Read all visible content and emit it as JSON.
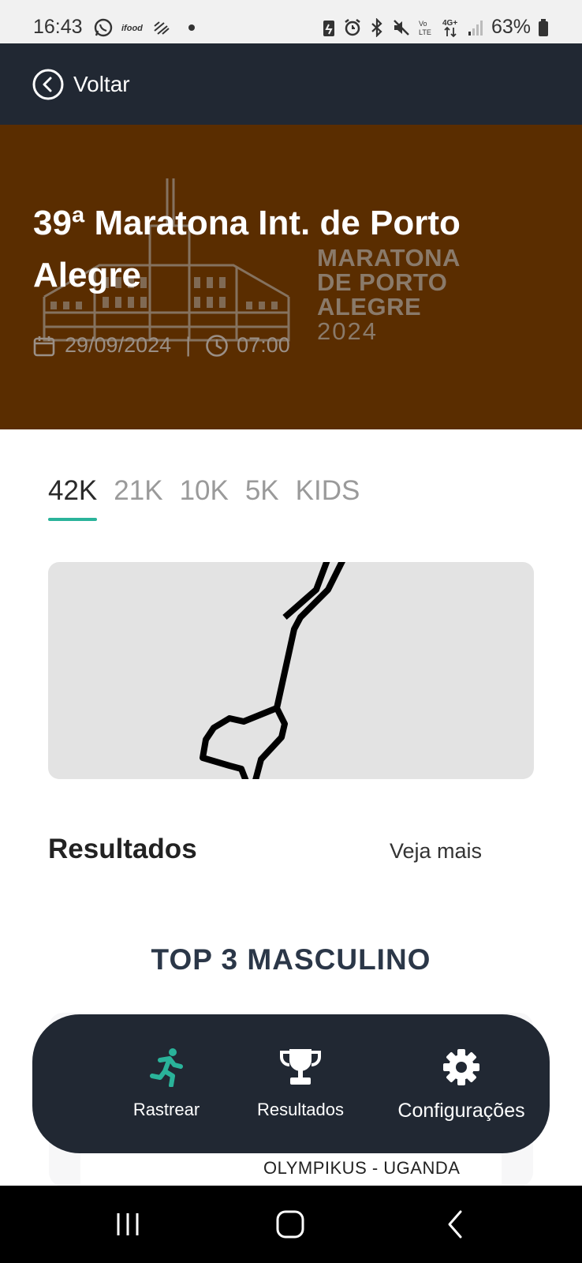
{
  "status_bar": {
    "time": "16:43",
    "left_icons": [
      "whatsapp-icon",
      "ifood-icon",
      "wave-icon",
      "dot-icon"
    ],
    "right_icons": [
      "battery-saver-icon",
      "alarm-icon",
      "bluetooth-icon",
      "mute-icon",
      "volte-icon",
      "4g-icon",
      "signal-icon",
      "battery-icon"
    ],
    "battery_percent": "63%",
    "volte_label": "Vo LTE",
    "network_label": "4G+"
  },
  "top_nav": {
    "back_label": "Voltar",
    "back_icon": "chevron-left-circle-icon"
  },
  "hero": {
    "title": "39ª Maratona Int. de Porto Alegre",
    "logo_text": [
      "MARATONA",
      "DE PORTO",
      "ALEGRE",
      "2024"
    ],
    "date": "29/09/2024",
    "separator": "|",
    "time": "07:00",
    "date_icon": "calendar-icon",
    "time_icon": "clock-icon",
    "background_color": "#5a2d00"
  },
  "tabs": [
    {
      "label": "42K",
      "active": true
    },
    {
      "label": "21K",
      "active": false
    },
    {
      "label": "10K",
      "active": false
    },
    {
      "label": "5K",
      "active": false
    },
    {
      "label": "KIDS",
      "active": false
    }
  ],
  "accent_color": "#2ab39a",
  "results": {
    "title": "Resultados",
    "see_more": "Veja mais",
    "podium_title": "TOP 3 MASCULINO",
    "first_entry_team": "OLYMPIKUS - UGANDA"
  },
  "bottom_nav": {
    "items": [
      {
        "label": "Rastrear",
        "icon": "runner-icon",
        "active": true
      },
      {
        "label": "Resultados",
        "icon": "trophy-icon",
        "active": false
      },
      {
        "label": "Configurações",
        "icon": "gear-icon",
        "active": false
      }
    ]
  },
  "system_nav": {
    "items": [
      "recent-apps-icon",
      "home-icon",
      "back-icon"
    ]
  }
}
